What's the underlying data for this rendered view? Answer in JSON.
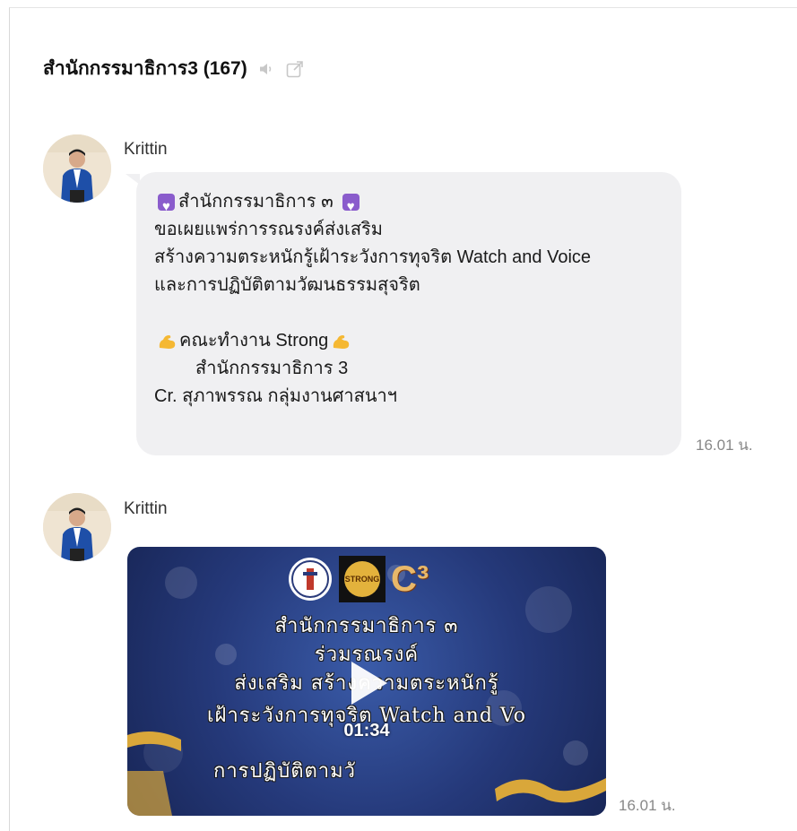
{
  "header": {
    "title": "สำนักกรรมาธิการ3 (167)",
    "icons": [
      "speaker-icon",
      "external-link-icon"
    ]
  },
  "messages": [
    {
      "sender": "Krittin",
      "lines": [
        "สำนักกรรมาธิการ ๓",
        "ขอเผยแพร่การรณรงค์ส่งเสริม",
        "สร้างความตระหนักรู้เฝ้าระวังการทุจริต Watch and Voice",
        "และการปฏิบัติตามวัฒนธรรมสุจริต",
        "",
        "คณะทำงาน Strong",
        "สำนักกรรมาธิการ 3",
        "Cr. สุภาพรรณ กลุ่มงานศาสนาฯ"
      ],
      "time": "16.01 น."
    },
    {
      "sender": "Krittin",
      "video": {
        "logo_text": "STRONG",
        "logo_c3": "C³",
        "overlay_lines": [
          "สำนักกรรมาธิการ ๓",
          "ร่วมรณรงค์",
          "ส่งเสริม สร้างความตระหนักรู้",
          "เฝ้าระวังการทุจริต Watch and Vo",
          "การปฏิบัติตามวั"
        ],
        "duration": "01:34"
      },
      "time": "16.01 น."
    }
  ],
  "colors": {
    "bubble": "#f0f0f2",
    "timestamp": "#888888",
    "heart_emoji": "#8a5ccc",
    "video_bg": "#25397a"
  }
}
